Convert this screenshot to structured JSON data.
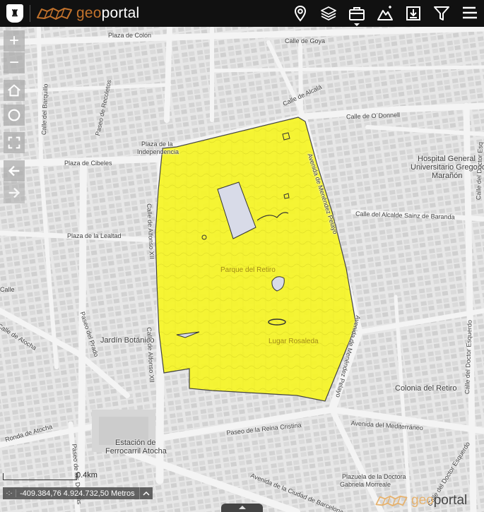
{
  "header": {
    "brand_geo": "geo",
    "brand_portal": "portal",
    "crest_icon": "madrid-crest-icon",
    "tools": [
      {
        "name": "location-pin-icon"
      },
      {
        "name": "layers-icon"
      },
      {
        "name": "briefcase-icon"
      },
      {
        "name": "mountain-measure-icon"
      },
      {
        "name": "download-icon"
      },
      {
        "name": "filter-icon"
      },
      {
        "name": "menu-icon"
      }
    ]
  },
  "controls": {
    "zoom_in": "+",
    "zoom_out": "−"
  },
  "map": {
    "highlight_color": "#f6f52a",
    "labels": {
      "plaza_colon": "Plaza de Colón",
      "calle_goya": "Calle de Goya",
      "calle_alcala": "Calle de Alcalá",
      "calle_odonnell": "Calle de O´Donnell",
      "calle_barquillo": "Calle del Barquillo",
      "paseo_recoletos": "Paseo de Recoletos",
      "plaza_independencia_1": "Plaza de la",
      "plaza_independencia_2": "Independencia",
      "plaza_cibeles": "Plaza de Cibeles",
      "avenida_menendez_pelayo_top": "Avenida de Menéndez Pelayo",
      "hospital_1": "Hospital  General",
      "hospital_2": "Universitario Gregorio",
      "hospital_3": "Marañón",
      "calle_doctor_esquerdo_top": "Calle del Doctor Esq",
      "calle_alcalde_saenz": "Calle del Alcalde Sainz de Baranda",
      "plaza_lealtad": "Plaza de la Lealtad",
      "calle_alfonso_xii_top": "Calle de Alfonso XII",
      "parque_retiro": "Parque del Retiro",
      "calle_edge": "Calle",
      "calle_atocha": "Calle de Atocha",
      "paseo_prado": "Paseo del Prado",
      "jardin_botanico": "Jardín  Botánico",
      "calle_alfonso_xii_bottom": "Calle de Alfonso XII",
      "lugar_rosaleda": "Lugar  Rosaleda",
      "avenida_menendez_pelayo_bottom": "Avenida de Menéndez Pelayo",
      "calle_doctor_esquerdo_bottom": "Calle del Doctor Esquerdo",
      "colonia_retiro": "Colonia del Retiro",
      "ronda_atocha": "Ronda de Atocha",
      "estacion_1": "Estación de",
      "estacion_2": "Ferrocarril  Atocha",
      "paseo_reina_cristina": "Paseo de la Reina Cristina",
      "avenida_mediterraneo": "Avenida del Mediterráneo",
      "paseo_delicias": "Paseo de las Delicias",
      "avenida_ciudad_barcelona": "Avenida de la Ciudad de Barcelona",
      "plazuela_1": "Plazuela de la Doctora",
      "plazuela_2": "Gabriela Morreale",
      "calle_doctor_esquerdo_vertical": "Calle del Doctor Esquerdo"
    }
  },
  "footer": {
    "scale_label": "0.4km",
    "coords_options": "·:·",
    "coordinates": "-409.384,76 4.924.732,50 Metros",
    "watermark_geo": "geo",
    "watermark_portal": "portal"
  }
}
